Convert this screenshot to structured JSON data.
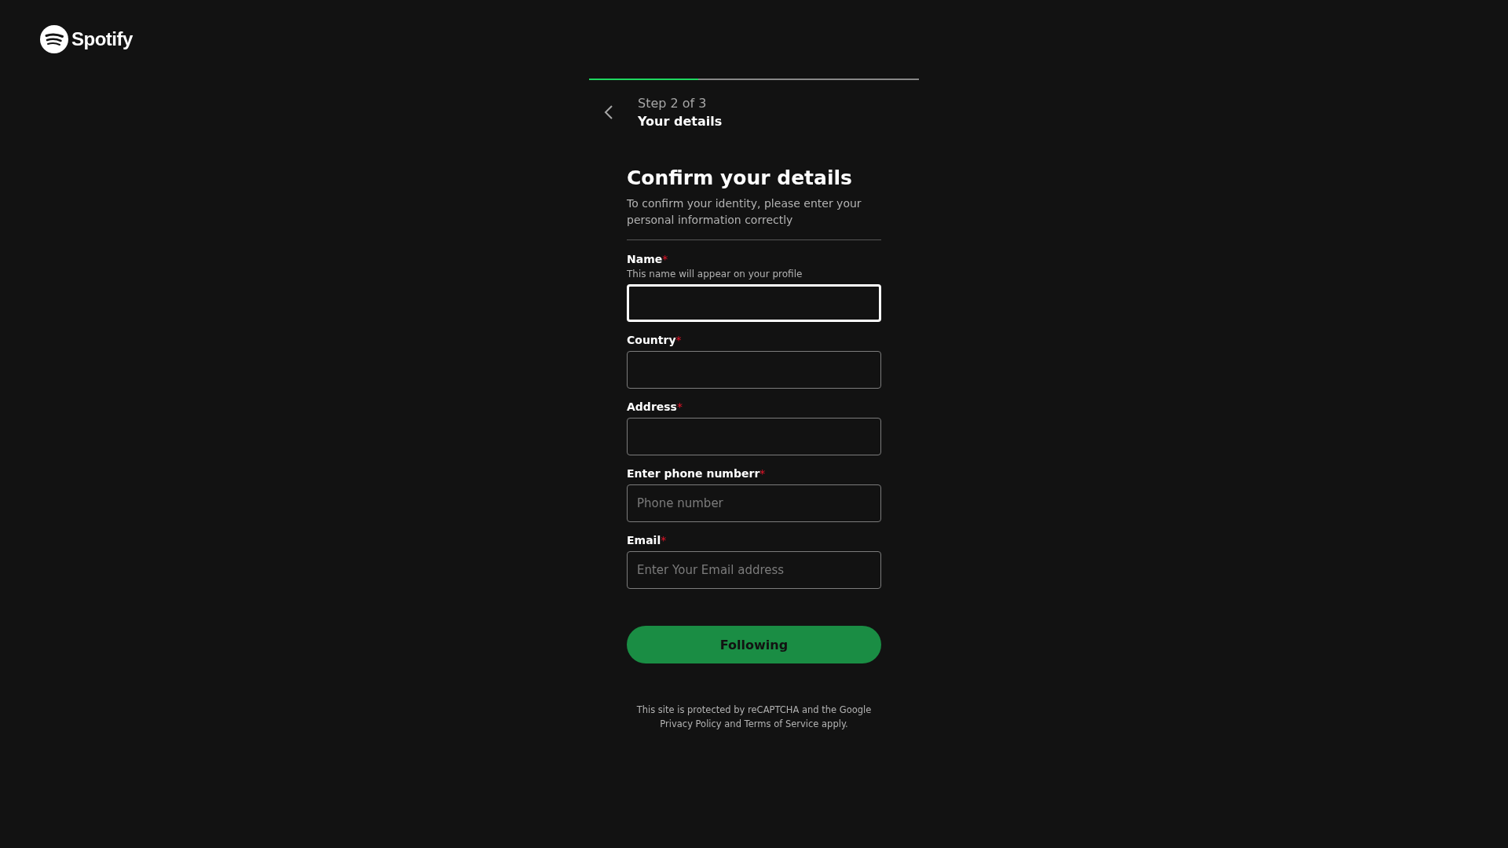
{
  "brand": {
    "name": "Spotify"
  },
  "progress": {
    "level": 0.33
  },
  "step": {
    "counter": "Step 2 of 3",
    "title": "Your details"
  },
  "form": {
    "heading": "Confirm your details",
    "description": "To confirm your identity, please enter your personal information correctly",
    "fields": [
      {
        "label": "Name",
        "required_mark": "*",
        "hint": "This name will appear on your profile",
        "focused": true
      },
      {
        "label": "Country",
        "required_mark": "*",
        "focused": false
      },
      {
        "label": "Address",
        "required_mark": "*",
        "focused": false
      },
      {
        "label": "Enter phone numberr",
        "required_mark": "*",
        "placeholder": "Phone number",
        "focused": false
      },
      {
        "label": "Email",
        "required_mark": "*",
        "placeholder": "Enter Your Email address",
        "focused": false
      }
    ],
    "submit": "Following",
    "legal": [
      "This site is protected by reCAPTCHA and the Google",
      "Privacy Policy and Terms of Service apply."
    ]
  }
}
